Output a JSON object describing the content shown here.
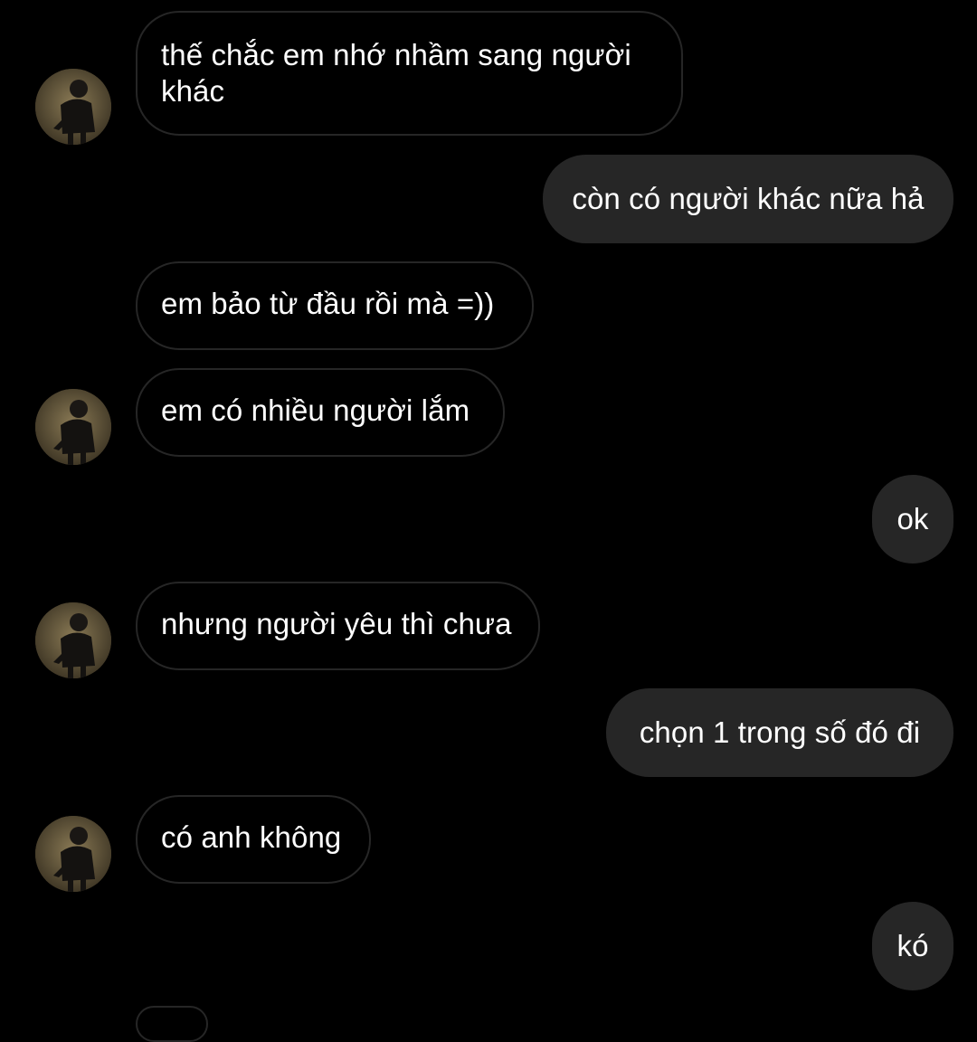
{
  "conversation": {
    "messages": [
      {
        "sender": "them",
        "text": "thế chắc em nhớ nhầm sang người khác",
        "show_avatar": true
      },
      {
        "sender": "me",
        "text": "còn có người khác nữa hả"
      },
      {
        "sender": "them",
        "text": "em bảo từ đầu rồi mà =))",
        "show_avatar": false
      },
      {
        "sender": "them",
        "text": "em có nhiều người lắm",
        "show_avatar": true
      },
      {
        "sender": "me",
        "text": "ok"
      },
      {
        "sender": "them",
        "text": "nhưng người yêu thì chưa",
        "show_avatar": true
      },
      {
        "sender": "me",
        "text": "chọn 1 trong số đó đi"
      },
      {
        "sender": "them",
        "text": "có anh không",
        "show_avatar": true
      },
      {
        "sender": "me",
        "text": "kó"
      }
    ]
  },
  "colors": {
    "background": "#000000",
    "outgoing_bubble": "#262626",
    "incoming_border": "#262626",
    "text": "#ffffff"
  },
  "icons": {
    "avatar": "profile-photo-avatar"
  }
}
